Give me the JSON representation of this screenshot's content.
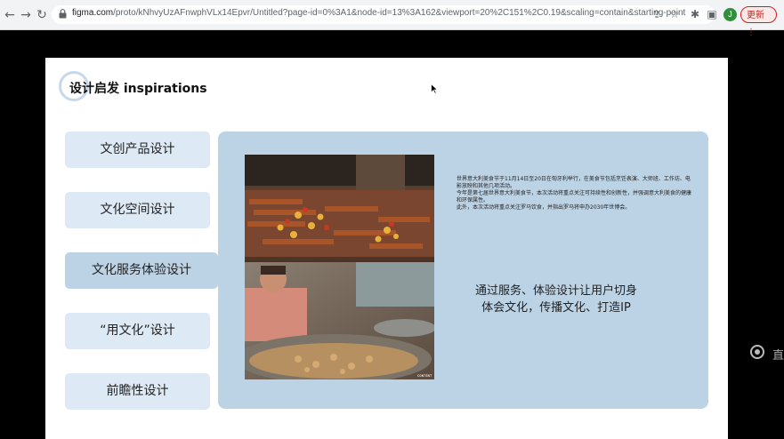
{
  "browser": {
    "url_domain": "figma.com",
    "url_path": "/proto/kNhvyUzAFnwphVLx14Epvr/Untitled?page-id=0%3A1&node-id=13%3A162&viewport=20%2C151%2C0.19&scaling=contain&starting-point-...",
    "profile_initial": "J",
    "update_label": "更新 ⋮",
    "icons": [
      "back-icon",
      "forward-icon",
      "reload-icon",
      "lock-icon",
      "share-icon",
      "star-icon",
      "extensions-icon",
      "sidebar-icon"
    ]
  },
  "slide": {
    "title": "设计启发 inspirations",
    "menu": [
      {
        "label": "文创产品设计",
        "active": false
      },
      {
        "label": "文化空间设计",
        "active": false
      },
      {
        "label": "文化服务体验设计",
        "active": true
      },
      {
        "label": "“用文化”设计",
        "active": false
      },
      {
        "label": "前瞻性设计",
        "active": false
      }
    ],
    "description": [
      "世界意大利美食节于11月14日至20日在匈牙利举行，在美食节包括烹饪表演、大师班、工作坊、电影放映和其他几项活动。",
      "今年是第七届世界意大利美食节，本次活动将重点关注可持续性和创新性，并强调意大利美食的健康和环保属性。",
      "此外，本次活动将重点关注罗马饮食，并指出罗马将申办2030年世博会。"
    ],
    "tagline_line1": "通过服务、体验设计让用户切身",
    "tagline_line2": "体会文化，传播文化、打造IP",
    "photo_watermark": "ᴄᴏɴᴛᴇɴᴛ"
  },
  "side": {
    "text": "直"
  },
  "colors": {
    "panel": "#bcd3e6",
    "menu": "#dde9f4",
    "update": "#c5221f"
  }
}
